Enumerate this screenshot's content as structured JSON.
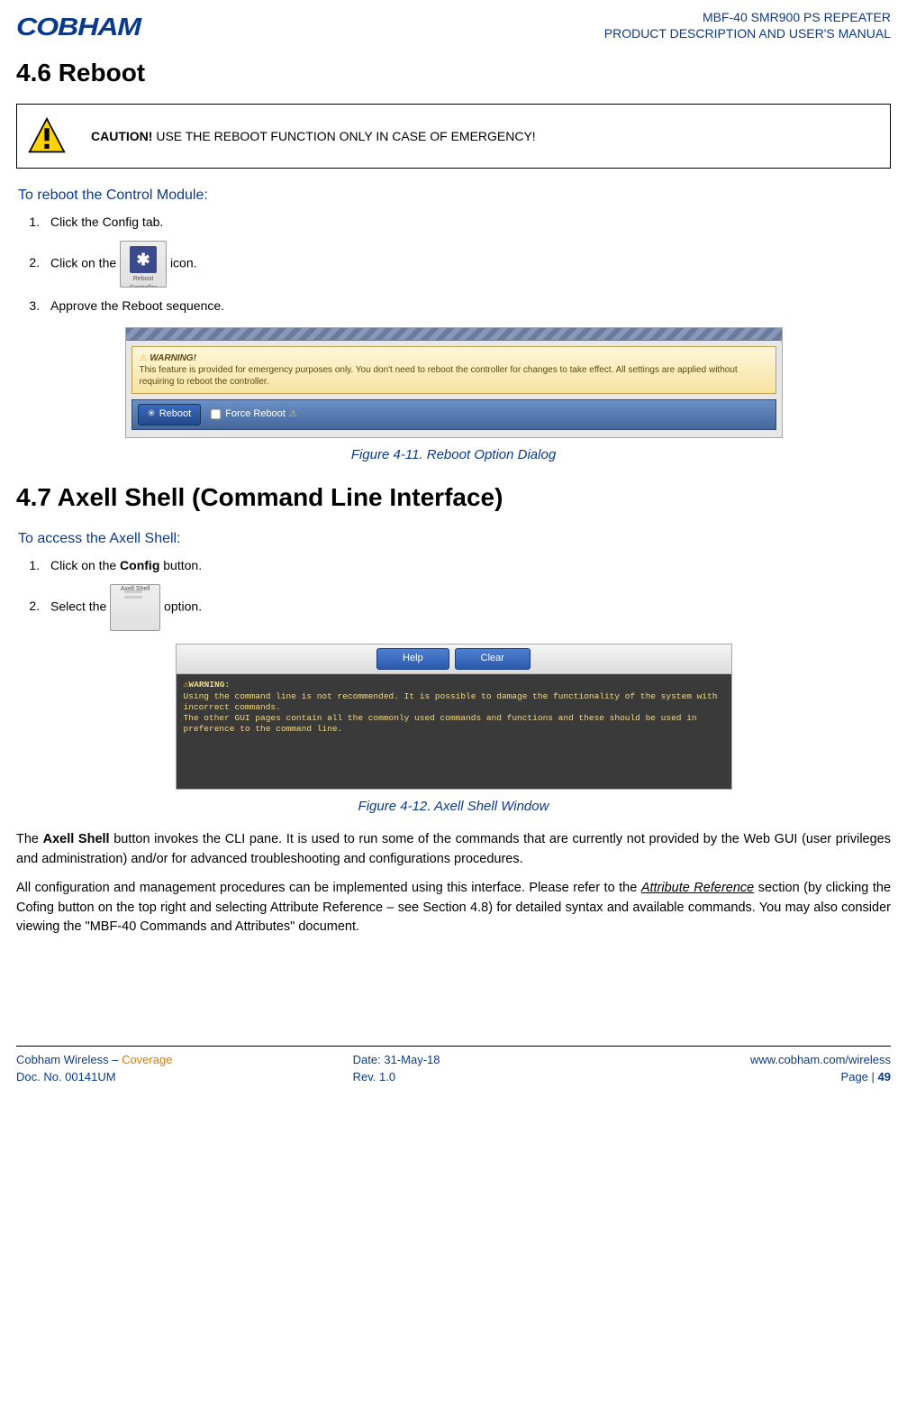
{
  "header": {
    "logo_text": "COBHAM",
    "product_line1": "MBF-40 SMR900 PS REPEATER",
    "product_line2": "PRODUCT DESCRIPTION AND USER'S MANUAL"
  },
  "sec46": {
    "heading": "4.6   Reboot",
    "caution_bold": "CAUTION!",
    "caution_text": " USE THE REBOOT FUNCTION ONLY IN CASE OF EMERGENCY!",
    "sub": "To reboot the Control Module:",
    "step1": "Click the Config tab.",
    "step2_a": "Click on the ",
    "step2_b": " icon.",
    "step3": "Approve the Reboot sequence.",
    "icon_label": "Reboot Controller",
    "dlg_warn_title": "WARNING!",
    "dlg_warn_body": "This feature is provided for emergency purposes only. You don't need to reboot the controller for changes to take effect. All settings are applied without requiring to reboot the controller.",
    "dlg_reboot_btn": "Reboot",
    "dlg_force": "Force Reboot",
    "figcap": "Figure 4-11. Reboot Option Dialog"
  },
  "sec47": {
    "heading": "4.7   Axell Shell (Command Line Interface)",
    "sub": "To access the Axell Shell:",
    "step1_a": "Click on the ",
    "step1_b": "Config",
    "step1_c": " button.",
    "step2_a": "Select the ",
    "step2_b": " option.",
    "icon_label": "Axell Shell",
    "btn_help": "Help",
    "btn_clear": "Clear",
    "term_warn": "WARNING:",
    "term_l1": "Using the command line is not recommended. It is possible to damage the functionality of the system with incorrect commands.",
    "term_l2": "The other GUI pages contain all the commonly used commands and functions and these should be used in preference to the command line.",
    "figcap": "Figure 4-12. Axell Shell Window",
    "para1_a": "The ",
    "para1_b": "Axell Shell",
    "para1_c": " button invokes the CLI pane. It is used to run some of the commands that are currently not provided by the Web GUI (user privileges and administration) and/or for advanced troubleshooting and configurations procedures.",
    "para2_a": "All configuration and management procedures can be implemented using this interface. Please refer to the ",
    "para2_b": "Attribute Reference",
    "para2_c": " section (by clicking the Cofing button on the top right and selecting Attribute Reference – see Section 4.8) for detailed syntax and available commands. You may also consider viewing the \"MBF-40 Commands and Attributes\" document."
  },
  "footer": {
    "brand": "Cobham Wireless",
    "dash": " – ",
    "coverage": "Coverage",
    "date": "Date: 31-May-18",
    "url": "www.cobham.com/wireless",
    "docno": "Doc. No. 00141UM",
    "rev": "Rev. 1.0",
    "page_a": "Page | ",
    "page_b": "49"
  }
}
